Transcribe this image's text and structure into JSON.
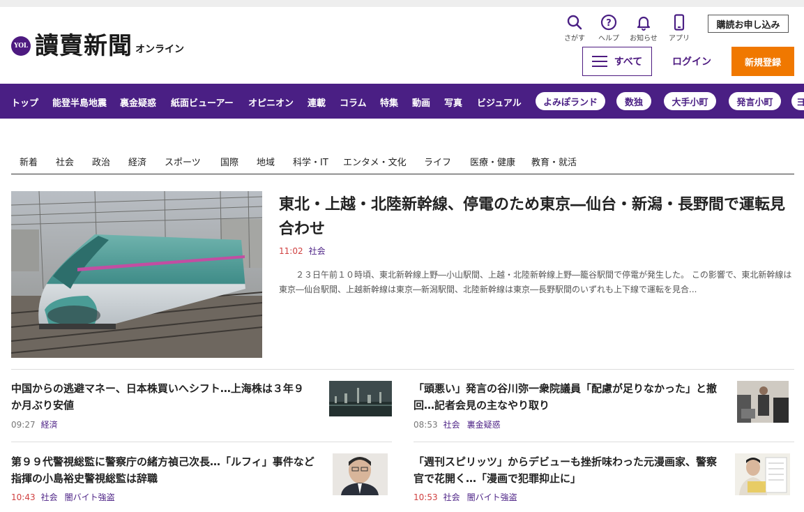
{
  "header": {
    "logo_badge": "YOL",
    "logo_main": "讀賣新聞",
    "logo_sub": "オンライン",
    "utilities": [
      {
        "label": "さがす",
        "icon": "search-icon"
      },
      {
        "label": "ヘルプ",
        "icon": "help-icon"
      },
      {
        "label": "お知らせ",
        "icon": "bell-icon"
      },
      {
        "label": "アプリ",
        "icon": "smartphone-icon"
      }
    ],
    "subscribe": "購読お申し込み",
    "menu": "すべて",
    "login": "ログイン",
    "register": "新規登録"
  },
  "main_nav": {
    "items": [
      "トップ",
      "能登半島地震",
      "裏金疑惑",
      "紙面ビューアー",
      "オピニオン",
      "連載",
      "コラム",
      "特集",
      "動画",
      "写真",
      "ビジュアル"
    ],
    "pills": [
      "よみぽランド",
      "数独",
      "大手小町",
      "発言小町",
      "ヨ"
    ]
  },
  "categories": [
    "新着",
    "社会",
    "政治",
    "経済",
    "スポーツ",
    "国際",
    "地域",
    "科学・IT",
    "エンタメ・文化",
    "ライフ",
    "医療・健康",
    "教育・就活"
  ],
  "top_story": {
    "title": "東北・上越・北陸新幹線、停電のため東京―仙台・新潟・長野間で運転見合わせ",
    "time": "11:02",
    "tags": [
      "社会"
    ],
    "body": "２３日午前１０時頃、東北新幹線上野―小山駅間、上越・北陸新幹線上野―籠谷駅間で停電が発生した。 この影響で、東北新幹線は東京―仙台駅間、上越新幹線は東京―新潟駅間、北陸新幹線は東京―長野駅間のいずれも上下線で運転を見合..."
  },
  "stories": [
    {
      "title": "中国からの逃避マネー、日本株買いへシフト…上海株は３年９か月ぶり安値",
      "time": "09:27",
      "tags": [
        "経済"
      ]
    },
    {
      "title": "「頭悪い」発言の谷川弥一衆院議員「配慮が足りなかった」と撤回…記者会見の主なやり取り",
      "time": "08:53",
      "tags": [
        "社会",
        "裏金疑惑"
      ]
    },
    {
      "title": "第９９代警視総監に警察庁の緒方禎己次長…「ルフィ」事件など指揮の小島裕史警視総監は辞職",
      "time": "10:43",
      "tags": [
        "社会",
        "闇バイト強盗"
      ]
    },
    {
      "title": "「週刊スピリッツ」からデビューも挫折味わった元漫画家、警察官で花開く…「漫画で犯罪抑止に」",
      "time": "10:53",
      "tags": [
        "社会",
        "闇バイト強盗"
      ]
    }
  ],
  "colors": {
    "brand_purple": "#4a1f84",
    "accent_orange": "#f07800",
    "time_red": "#d04040"
  }
}
